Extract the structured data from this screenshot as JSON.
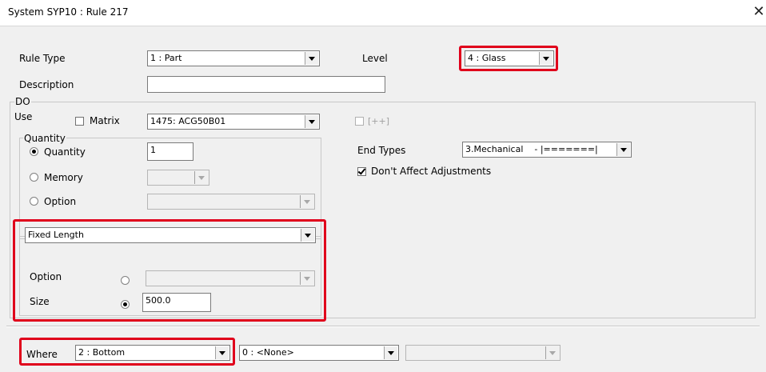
{
  "window": {
    "title": "System SYP10 : Rule 217",
    "close_glyph": "✕"
  },
  "rule_type": {
    "label": "Rule Type",
    "value": "1 : Part"
  },
  "level": {
    "label": "Level",
    "value": "4 : Glass"
  },
  "description": {
    "label": "Description",
    "value": ""
  },
  "do_group": {
    "title": "DO",
    "use_label": "Use",
    "matrix_label": "Matrix",
    "matrix_checked": false,
    "part_value": "1475: ACG50B01",
    "plusplus_label": "[++]",
    "plusplus_checked": false
  },
  "quantity_group": {
    "title": "Quantity",
    "options": [
      {
        "label": "Quantity",
        "selected": true
      },
      {
        "label": "Memory",
        "selected": false
      },
      {
        "label": "Option",
        "selected": false
      }
    ],
    "quantity_value": "1"
  },
  "length_group": {
    "mode": "Fixed Length",
    "option_label": "Option",
    "size_label": "Size",
    "option_selected": false,
    "size_selected": true,
    "size_value": "500.0"
  },
  "end_types": {
    "label": "End Types",
    "value": "3.Mechanical    - |=======|",
    "dont_affect_label": "Don't Affect Adjustments",
    "dont_affect_checked": true
  },
  "where": {
    "label": "Where",
    "value": "2 : Bottom",
    "secondary_value": "0 : <None>",
    "tertiary_value": ""
  },
  "colors": {
    "highlight": "#e0001b",
    "dialog_bg": "#f0f0f0"
  }
}
